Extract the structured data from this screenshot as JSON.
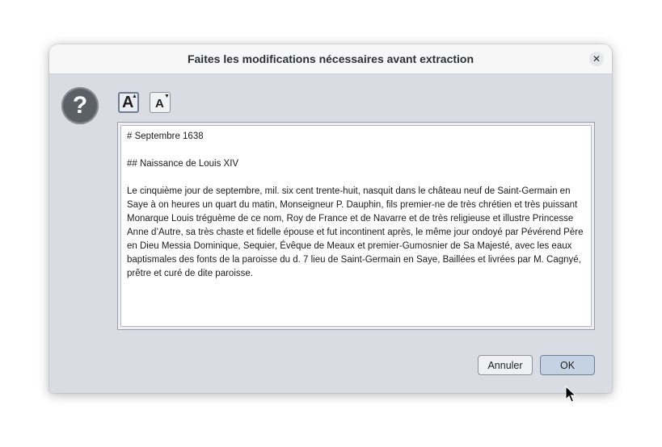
{
  "dialog": {
    "title": "Faites les modifications nécessaires avant extraction",
    "close_icon": "close-icon",
    "message_icon": "question-mark-icon",
    "question_glyph": "?"
  },
  "toolbar": {
    "increase_font": {
      "glyph": "A",
      "icon": "font-increase-icon"
    },
    "decrease_font": {
      "glyph": "A",
      "icon": "font-decrease-icon"
    }
  },
  "editor": {
    "paragraphs": [
      "# Septembre 1638",
      "## Naissance de Louis XIV",
      "Le cinquième jour de septembre, mil. six cent trente-huit, nasquit dans le château neuf de Saint-Germain en Saye à on heures un quart du matin, Monseigneur P. Dauphin, fils premier-ne de très chrétien et très puissant Monarque Louis tréguème de ce nom, Roy de France et de Navarre et de très religieuse et illustre Princesse Anne d’Autre, sa très chaste et fidelle épouse et fut incontinent après, le même jour ondoyé par Pévérend Père en Dieu Messia Dominique, Sequier, Évêque de Meaux et premier-Gumosnier de Sa Majesté, avec les eaux baptismales des fonts de la paroisse du d. 7 lieu de Saint-Germain en Saye, Baillées et livrées par M. Cagnyé, prêtre et curé de dite paroisse."
    ]
  },
  "buttons": {
    "cancel": "Annuler",
    "ok": "OK"
  },
  "colors": {
    "dialog_background": "#d9dce3",
    "titlebar_background": "#f7f7f8",
    "default_button": "#c5d2e4"
  }
}
